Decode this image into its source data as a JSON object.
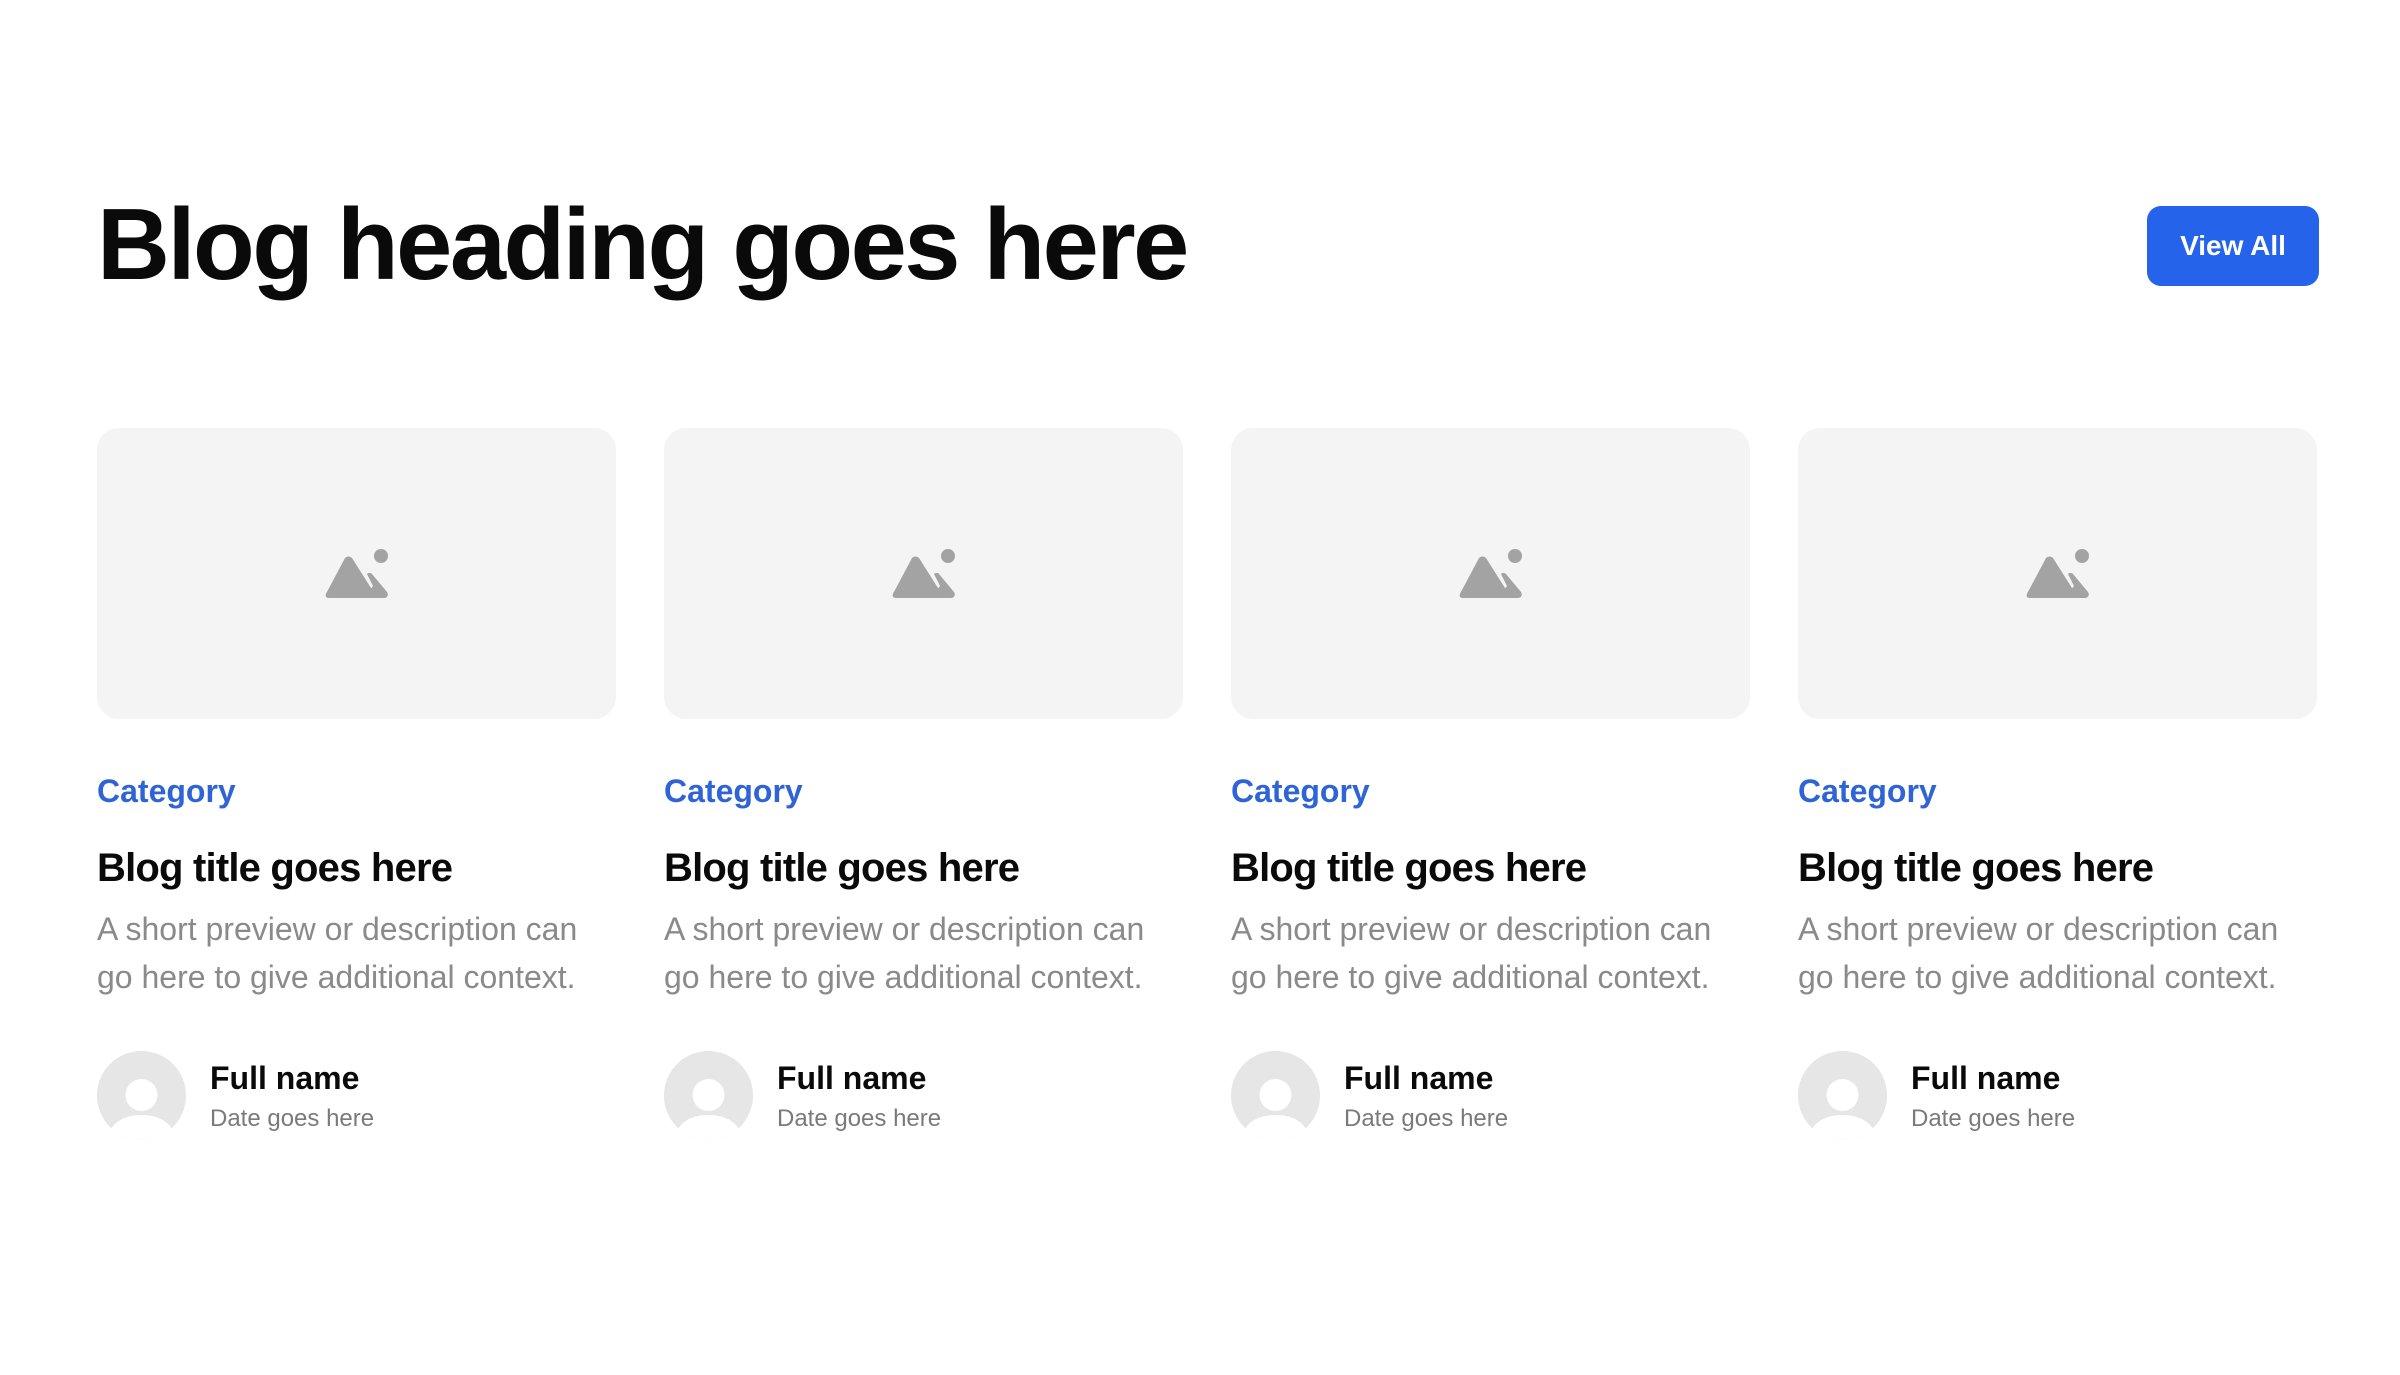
{
  "header": {
    "heading": "Blog heading goes here",
    "view_all_label": "View All"
  },
  "colors": {
    "accent": "#2563eb",
    "category": "#2f64d6",
    "placeholder_bg": "#f4f4f4",
    "muted_text": "#8a8a8a"
  },
  "posts": [
    {
      "image_icon": "image-placeholder-icon",
      "category": "Category",
      "title": "Blog title goes here",
      "description": "A short preview or description can go here to give additional context.",
      "author": {
        "avatar_icon": "avatar-placeholder-icon",
        "name": "Full name",
        "date": "Date goes here"
      }
    },
    {
      "image_icon": "image-placeholder-icon",
      "category": "Category",
      "title": "Blog title goes here",
      "description": "A short preview or description can go here to give additional context.",
      "author": {
        "avatar_icon": "avatar-placeholder-icon",
        "name": "Full name",
        "date": "Date goes here"
      }
    },
    {
      "image_icon": "image-placeholder-icon",
      "category": "Category",
      "title": "Blog title goes here",
      "description": "A short preview or description can go here to give additional context.",
      "author": {
        "avatar_icon": "avatar-placeholder-icon",
        "name": "Full name",
        "date": "Date goes here"
      }
    },
    {
      "image_icon": "image-placeholder-icon",
      "category": "Category",
      "title": "Blog title goes here",
      "description": "A short preview or description can go here to give additional context.",
      "author": {
        "avatar_icon": "avatar-placeholder-icon",
        "name": "Full name",
        "date": "Date goes here"
      }
    }
  ]
}
